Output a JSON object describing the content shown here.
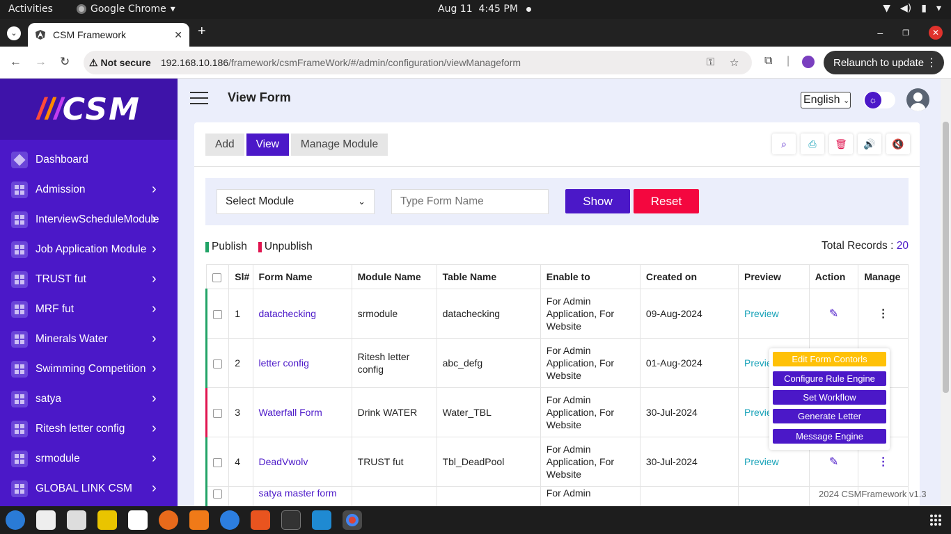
{
  "system": {
    "activities": "Activities",
    "app_name": "Google Chrome",
    "date": "Aug 11",
    "time": "4:45 PM"
  },
  "browser": {
    "tab_title": "CSM Framework",
    "security": "Not secure",
    "url_host": "192.168.10.186",
    "url_path": "/framework/csmFrameWork/#/admin/configuration/viewManageform",
    "relaunch": "Relaunch to update"
  },
  "sidebar": {
    "logo": "CSM",
    "items": [
      {
        "label": "Dashboard",
        "has_arrow": false
      },
      {
        "label": "Admission",
        "has_arrow": true
      },
      {
        "label": "InterviewScheduleModule",
        "has_arrow": true
      },
      {
        "label": "Job Application Module",
        "has_arrow": true
      },
      {
        "label": "TRUST fut",
        "has_arrow": true
      },
      {
        "label": "MRF fut",
        "has_arrow": true
      },
      {
        "label": "Minerals Water",
        "has_arrow": true
      },
      {
        "label": "Swimming Competition",
        "has_arrow": true
      },
      {
        "label": "satya",
        "has_arrow": true
      },
      {
        "label": "Ritesh letter config",
        "has_arrow": true
      },
      {
        "label": "srmodule",
        "has_arrow": true
      },
      {
        "label": "GLOBAL LINK CSM",
        "has_arrow": true
      }
    ]
  },
  "header": {
    "title": "View Form",
    "language": "English"
  },
  "tabs": [
    "Add",
    "View",
    "Manage Module"
  ],
  "filter": {
    "module_placeholder": "Select Module",
    "form_placeholder": "Type Form Name",
    "show": "Show",
    "reset": "Reset"
  },
  "legend": {
    "publish": "Publish",
    "unpublish": "Unpublish",
    "publish_color": "#21a366",
    "unpublish_color": "#e0144f"
  },
  "total": {
    "label": "Total Records :",
    "value": "20"
  },
  "table": {
    "columns": [
      "Sl#",
      "Form Name",
      "Module Name",
      "Table Name",
      "Enable to",
      "Created on",
      "Preview",
      "Action",
      "Manage"
    ],
    "rows": [
      {
        "sl": "1",
        "form": "datachecking",
        "module": "srmodule",
        "table": "datachecking",
        "enable": "For Admin Application, For Website",
        "created": "09-Aug-2024",
        "preview": "Preview",
        "status": "publish"
      },
      {
        "sl": "2",
        "form": "letter config",
        "module": "Ritesh letter config",
        "table": "abc_defg",
        "enable": "For Admin Application, For Website",
        "created": "01-Aug-2024",
        "preview": "Preview",
        "status": "publish"
      },
      {
        "sl": "3",
        "form": "Waterfall Form",
        "module": "Drink WATER",
        "table": "Water_TBL",
        "enable": "For Admin Application, For Website",
        "created": "30-Jul-2024",
        "preview": "Preview",
        "status": "unpublish"
      },
      {
        "sl": "4",
        "form": "DeadVwolv",
        "module": "TRUST fut",
        "table": "Tbl_DeadPool",
        "enable": "For Admin Application, For Website",
        "created": "30-Jul-2024",
        "preview": "Preview",
        "status": "publish"
      },
      {
        "sl": "",
        "form": "satya master form",
        "module": "",
        "table": "",
        "enable": "For Admin",
        "created": "",
        "preview": "",
        "status": "publish"
      }
    ]
  },
  "dropdown": [
    "Edit Form Contorls",
    "Configure Rule Engine",
    "Set Workflow",
    "Generate Letter",
    "Message Engine"
  ],
  "footer": "2024 CSMFramework v1.3"
}
